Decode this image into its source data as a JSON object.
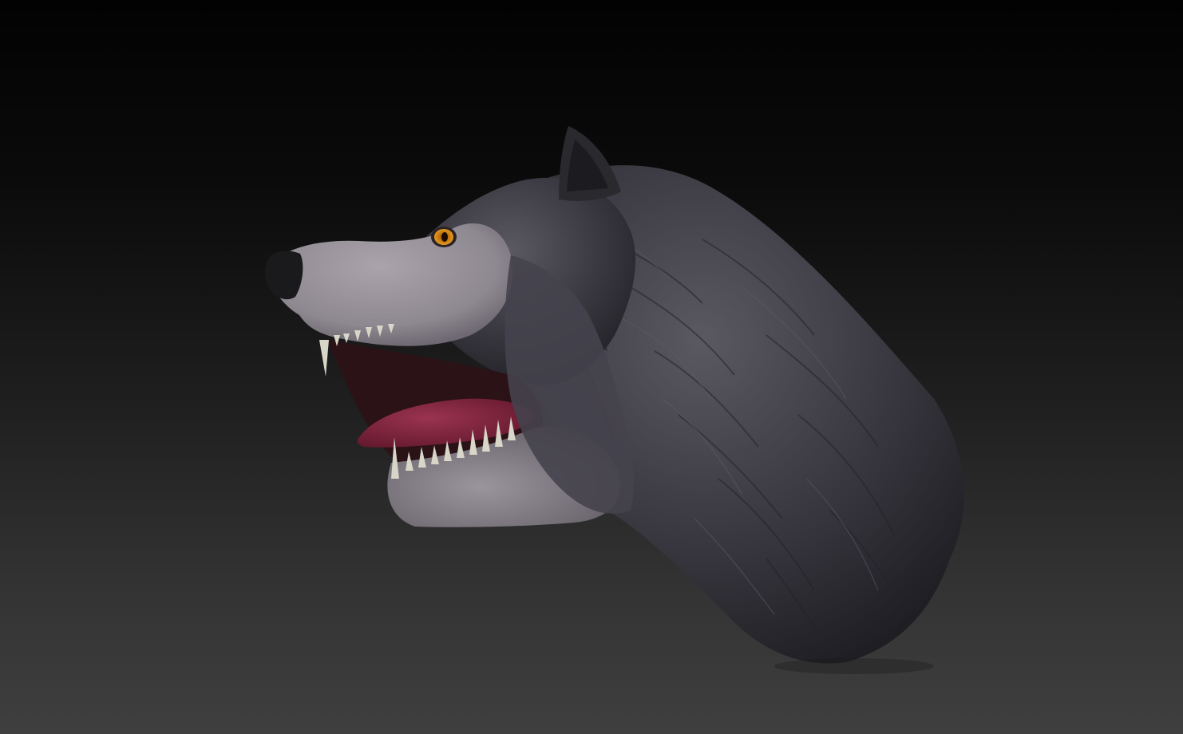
{
  "viewport": {
    "kind": "3d-sculpt-viewport",
    "background_top": "#020202",
    "background_bottom": "#3f3f3f"
  },
  "model": {
    "subject": "wolf-head-bust",
    "colors": {
      "fur": "#3b3a42",
      "fur_highlight": "#5a5861",
      "muzzle": "#8e8890",
      "nose": "#1a1a1c",
      "eye_iris": "#d98a10",
      "tongue": "#7a2238",
      "teeth": "#d8d6c8",
      "ear": "#2a2a2e"
    }
  }
}
